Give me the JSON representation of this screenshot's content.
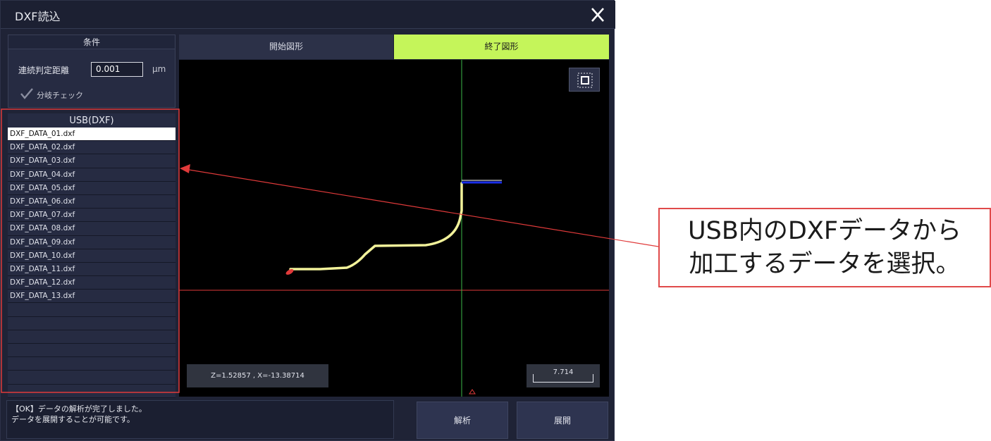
{
  "window": {
    "title": "DXF読込"
  },
  "conditions": {
    "heading": "条件",
    "distance_label": "連続判定距離",
    "distance_value": "0.001",
    "distance_unit": "μm",
    "branch_check_label": "分岐チェック",
    "branch_checked": true
  },
  "usb": {
    "heading": "USB(DXF)",
    "files": [
      "DXF_DATA_01.dxf",
      "DXF_DATA_02.dxf",
      "DXF_DATA_03.dxf",
      "DXF_DATA_04.dxf",
      "DXF_DATA_05.dxf",
      "DXF_DATA_06.dxf",
      "DXF_DATA_07.dxf",
      "DXF_DATA_08.dxf",
      "DXF_DATA_09.dxf",
      "DXF_DATA_10.dxf",
      "DXF_DATA_11.dxf",
      "DXF_DATA_12.dxf",
      "DXF_DATA_13.dxf"
    ],
    "selected_index": 0
  },
  "tabs": {
    "start_label": "開始図形",
    "end_label": "終了図形",
    "active": "end"
  },
  "viewer": {
    "coordinates": "Z=1.52857 , X=-13.38714",
    "scale_value": "7.714"
  },
  "status": {
    "line1": "【OK】データの解析が完了しました。",
    "line2": "データを展開することが可能です。"
  },
  "buttons": {
    "analyze_label": "解析",
    "expand_label": "展開"
  },
  "annotation": {
    "line1": "USB内のDXFデータから",
    "line2": "加工するデータを選択。"
  },
  "colors": {
    "accent_tab": "#c5f55a",
    "path_curve": "#f2f29a",
    "path_end_segment": "#1a2ee8",
    "axis_horizontal": "#e03a3a",
    "axis_vertical": "#3bb84a",
    "annotation_border": "#e04a4a"
  }
}
